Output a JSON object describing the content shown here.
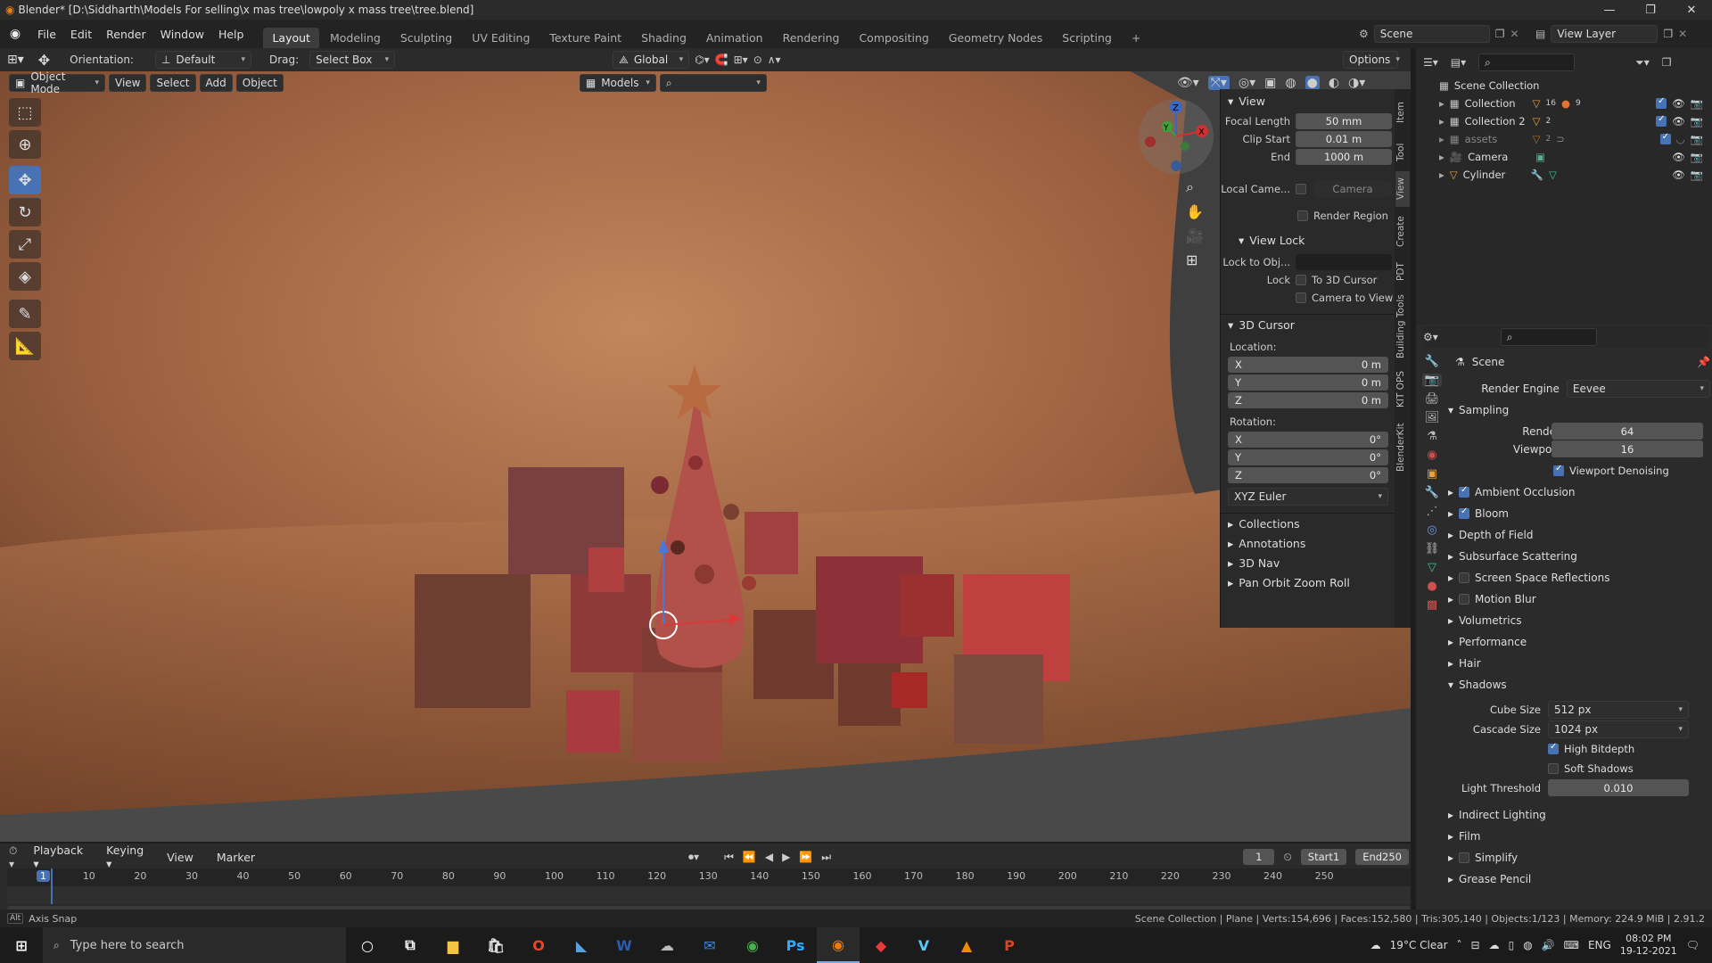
{
  "title_bar": {
    "title": "Blender* [D:\\Siddharth\\Models For selling\\x mas tree\\lowpoly x mass tree\\tree.blend]",
    "minimize": "—",
    "maximize": "❐",
    "close": "✕"
  },
  "menu": {
    "items": [
      "File",
      "Edit",
      "Render",
      "Window",
      "Help"
    ]
  },
  "workspaces": {
    "tabs": [
      "Layout",
      "Modeling",
      "Sculpting",
      "UV Editing",
      "Texture Paint",
      "Shading",
      "Animation",
      "Rendering",
      "Compositing",
      "Geometry Nodes",
      "Scripting"
    ],
    "active": "Layout",
    "add": "+"
  },
  "top_right": {
    "scene": "Scene",
    "view_layer": "View Layer"
  },
  "viewport_tool_header": {
    "orientation_label": "Orientation:",
    "orientation_value": "Default",
    "drag_label": "Drag:",
    "drag_value": "Select Box",
    "transform_orientation": "Global",
    "options": "Options"
  },
  "viewport_header": {
    "mode": "Object Mode",
    "menus": [
      "View",
      "Select",
      "Add",
      "Object"
    ],
    "collection_filter": "Models"
  },
  "npanel": {
    "view_title": "View",
    "focal_length_label": "Focal Length",
    "focal_length": "50 mm",
    "clip_start_label": "Clip Start",
    "clip_start": "0.01 m",
    "end_label": "End",
    "end": "1000 m",
    "local_camera_label": "Local Came...",
    "local_camera_value": "Camera",
    "render_region": "Render Region",
    "view_lock_title": "View Lock",
    "lock_to_obj_label": "Lock to Obj...",
    "lock_label": "Lock",
    "to_3d_cursor": "To 3D Cursor",
    "camera_to_view": "Camera to View",
    "cursor_title": "3D Cursor",
    "location_label": "Location:",
    "rotation_label": "Rotation:",
    "location": [
      {
        "axis": "X",
        "value": "0 m"
      },
      {
        "axis": "Y",
        "value": "0 m"
      },
      {
        "axis": "Z",
        "value": "0 m"
      }
    ],
    "rotation": [
      {
        "axis": "X",
        "value": "0°"
      },
      {
        "axis": "Y",
        "value": "0°"
      },
      {
        "axis": "Z",
        "value": "0°"
      }
    ],
    "rotation_mode": "XYZ Euler",
    "collapsed": [
      "Collections",
      "Annotations",
      "3D Nav",
      "Pan Orbit Zoom Roll"
    ]
  },
  "side_tabs": [
    "Item",
    "Tool",
    "View",
    "Create",
    "PDT",
    "Building Tools",
    "KIT OPS",
    "BlenderKit"
  ],
  "gizmo": {
    "x": "X",
    "y": "Y",
    "z": "Z"
  },
  "outliner": {
    "root": "Scene Collection",
    "items": [
      {
        "name": "Collection",
        "badge": "16",
        "badge2": "9"
      },
      {
        "name": "Collection 2",
        "badge": "2"
      },
      {
        "name": "assets",
        "badge": "2"
      },
      {
        "name": "Camera"
      },
      {
        "name": "Cylinder"
      }
    ]
  },
  "properties": {
    "scene": "Scene",
    "render_engine_label": "Render Engine",
    "render_engine": "Eevee",
    "sampling": "Sampling",
    "render_label": "Render",
    "render_samples": "64",
    "viewport_label": "Viewport",
    "viewport_samples": "16",
    "viewport_denoising": "Viewport Denoising",
    "panels": [
      {
        "label": "Ambient Occlusion",
        "check": true
      },
      {
        "label": "Bloom",
        "check": true
      },
      {
        "label": "Depth of Field"
      },
      {
        "label": "Subsurface Scattering"
      },
      {
        "label": "Screen Space Reflections",
        "check": false
      },
      {
        "label": "Motion Blur",
        "check": false
      },
      {
        "label": "Volumetrics"
      },
      {
        "label": "Performance"
      },
      {
        "label": "Hair"
      }
    ],
    "shadows": "Shadows",
    "cube_size_label": "Cube Size",
    "cube_size": "512 px",
    "cascade_size_label": "Cascade Size",
    "cascade_size": "1024 px",
    "high_bitdepth": "High Bitdepth",
    "soft_shadows": "Soft Shadows",
    "light_threshold_label": "Light Threshold",
    "light_threshold": "0.010",
    "after": [
      "Indirect Lighting",
      "Film",
      "Simplify",
      "Grease Pencil"
    ]
  },
  "timeline": {
    "menus": [
      "Playback",
      "Keying",
      "View",
      "Marker"
    ],
    "current_frame": "1",
    "start_label": "Start",
    "start": "1",
    "end_label": "End",
    "end": "250",
    "ticks": [
      "1",
      "10",
      "20",
      "30",
      "40",
      "50",
      "60",
      "70",
      "80",
      "90",
      "100",
      "110",
      "120",
      "130",
      "140",
      "150",
      "160",
      "170",
      "180",
      "190",
      "200",
      "210",
      "220",
      "230",
      "240",
      "250"
    ]
  },
  "status": {
    "left_key": "Alt",
    "left": "Axis Snap",
    "right": "Scene Collection | Plane | Verts:154,696 | Faces:152,580 | Tris:305,140 | Objects:1/123 | Memory: 224.9 MiB | 2.91.2"
  },
  "taskbar": {
    "search": "Type here to search",
    "weather": "19°C Clear",
    "lang": "ENG",
    "time": "08:02 PM",
    "date": "19-12-2021"
  }
}
